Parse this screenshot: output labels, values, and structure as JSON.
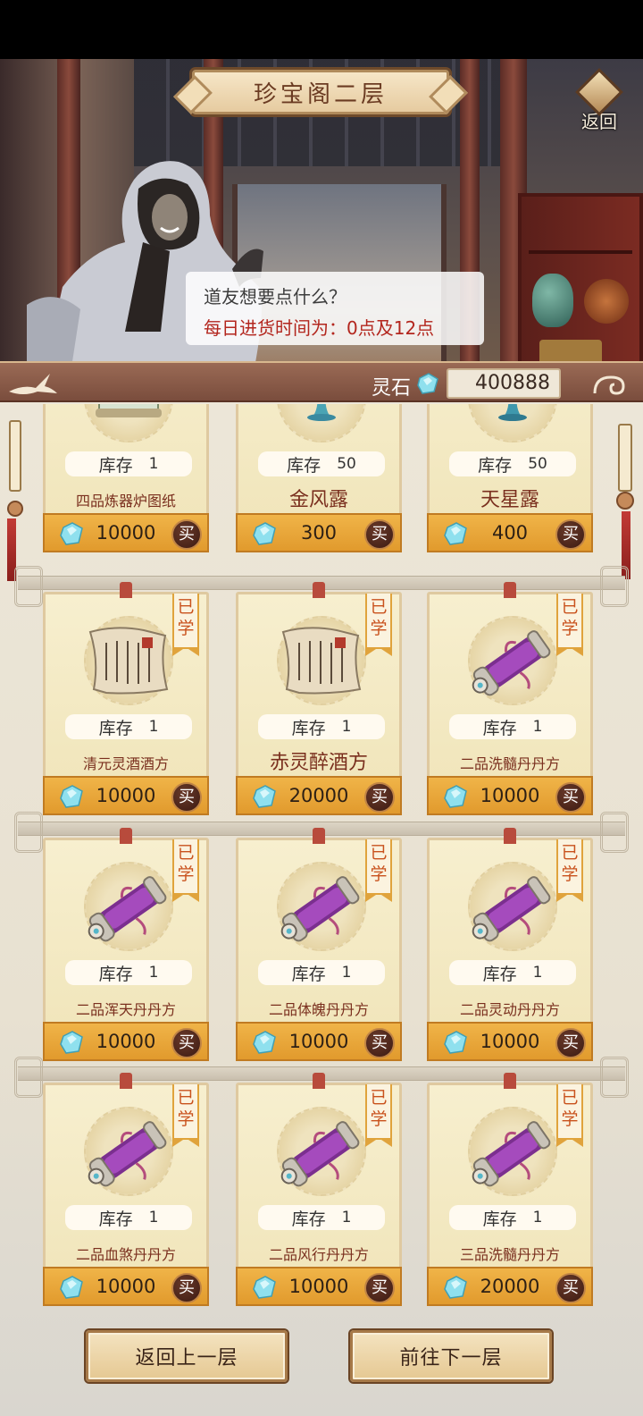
{
  "header": {
    "title": "珍宝阁二层",
    "back_label": "返回"
  },
  "npc": {
    "line1": "道友想要点什么？",
    "line2": "每日进货时间为：0点及12点"
  },
  "currency": {
    "label": "灵石",
    "amount": "400888"
  },
  "shop": {
    "stock_label": "库存",
    "buy_label": "买",
    "learned_label_top": "已",
    "learned_label_bottom": "学",
    "items": [
      {
        "name": "四品炼器炉图纸",
        "stock": "1",
        "price": "10000",
        "icon": "blueprint-scroll-icon",
        "learned": false
      },
      {
        "name": "金风露",
        "stock": "50",
        "price": "300",
        "icon": "gold-dew-icon",
        "learned": false
      },
      {
        "name": "天星露",
        "stock": "50",
        "price": "400",
        "icon": "star-dew-icon",
        "learned": false
      },
      {
        "name": "清元灵酒酒方",
        "stock": "1",
        "price": "10000",
        "icon": "recipe-paper-icon",
        "learned": true
      },
      {
        "name": "赤灵醉酒方",
        "stock": "1",
        "price": "20000",
        "icon": "recipe-paper-icon",
        "learned": true
      },
      {
        "name": "二品洗髓丹丹方",
        "stock": "1",
        "price": "10000",
        "icon": "purple-scroll-icon",
        "learned": true
      },
      {
        "name": "二品浑天丹丹方",
        "stock": "1",
        "price": "10000",
        "icon": "purple-scroll-icon",
        "learned": true
      },
      {
        "name": "二品体魄丹丹方",
        "stock": "1",
        "price": "10000",
        "icon": "purple-scroll-icon",
        "learned": true
      },
      {
        "name": "二品灵动丹丹方",
        "stock": "1",
        "price": "10000",
        "icon": "purple-scroll-icon",
        "learned": true
      },
      {
        "name": "二品血煞丹丹方",
        "stock": "1",
        "price": "10000",
        "icon": "purple-scroll-icon",
        "learned": true
      },
      {
        "name": "二品风行丹丹方",
        "stock": "1",
        "price": "10000",
        "icon": "purple-scroll-icon",
        "learned": true
      },
      {
        "name": "三品洗髓丹丹方",
        "stock": "1",
        "price": "20000",
        "icon": "purple-scroll-icon",
        "learned": true
      }
    ]
  },
  "footer": {
    "prev_floor": "返回上一层",
    "next_floor": "前往下一层"
  },
  "colors": {
    "accent_gold": "#e19a2d",
    "title_brown": "#6b3b22",
    "item_name": "#7a2f1e",
    "notice_red": "#b3261e",
    "gem_blue": "#7fd3e6"
  }
}
